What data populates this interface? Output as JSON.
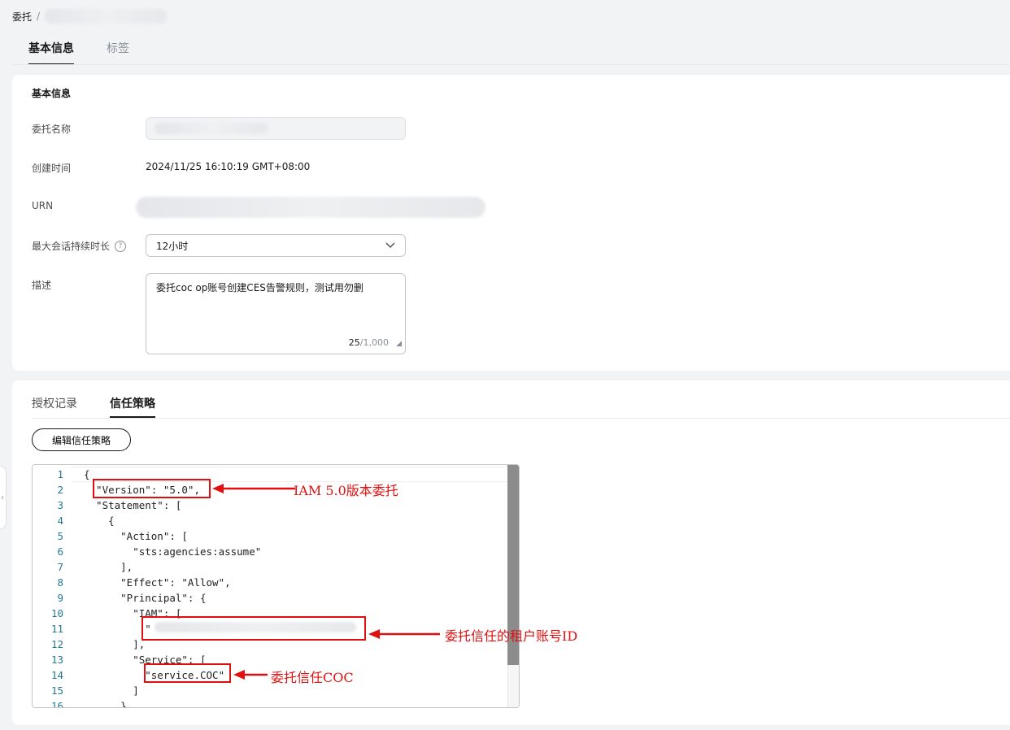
{
  "breadcrumb": {
    "root": "委托",
    "separator": "/"
  },
  "tabs": [
    {
      "label": "基本信息",
      "active": true
    },
    {
      "label": "标签",
      "active": false
    }
  ],
  "basic_info": {
    "section_title": "基本信息",
    "name_label": "委托名称",
    "created_label": "创建时间",
    "created_value": "2024/11/25 16:10:19 GMT+08:00",
    "urn_label": "URN",
    "max_session_label": "最大会话持续时长",
    "max_session_value": "12小时",
    "description_label": "描述",
    "description_value": "委托coc op账号创建CES告警规则，测试用勿删",
    "desc_count": "25",
    "desc_max": "/1,000"
  },
  "sub_tabs": [
    {
      "label": "授权记录",
      "active": false
    },
    {
      "label": "信任策略",
      "active": true
    }
  ],
  "edit_button_label": "编辑信任策略",
  "code_lines": [
    "{",
    "  \"Version\": \"5.0\",",
    "  \"Statement\": [",
    "    {",
    "      \"Action\": [",
    "        \"sts:agencies:assume\"",
    "      ],",
    "      \"Effect\": \"Allow\",",
    "      \"Principal\": {",
    "        \"IAM\": [",
    "          \"",
    "        ],",
    "        \"Service\": [",
    "          \"service.COC\"",
    "        ]",
    "      }"
  ],
  "line_numbers": [
    "1",
    "2",
    "3",
    "4",
    "5",
    "6",
    "7",
    "8",
    "9",
    "10",
    "11",
    "12",
    "13",
    "14",
    "15",
    "16"
  ],
  "annotations": {
    "version": "IAM 5.0版本委托",
    "account": "委托信任的租户账号ID",
    "service": "委托信任COC"
  },
  "colors": {
    "annotation": "#e01010",
    "accent": "#191919"
  }
}
